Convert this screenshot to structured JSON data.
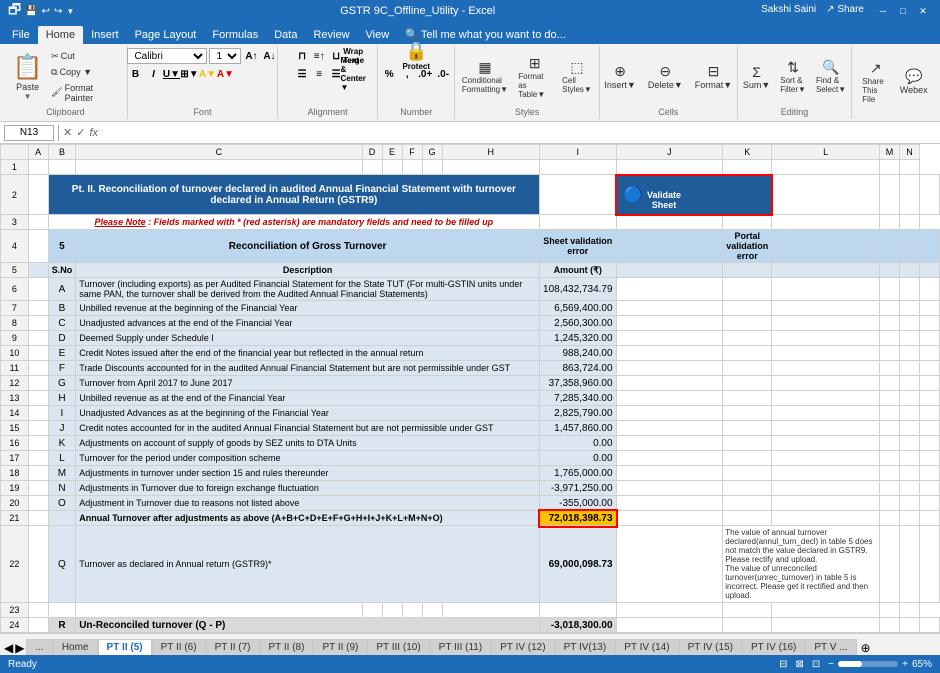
{
  "titleBar": {
    "title": "GSTR 9C_Offline_Utility - Excel",
    "minimize": "─",
    "maximize": "□",
    "close": "✕"
  },
  "tabs": [
    "File",
    "Home",
    "Insert",
    "Page Layout",
    "Formulas",
    "Data",
    "Review",
    "View",
    "Tell me what you want to do..."
  ],
  "activeTab": "Home",
  "ribbon": {
    "groups": [
      {
        "label": "Clipboard",
        "name": "clipboard"
      },
      {
        "label": "Font",
        "name": "font"
      },
      {
        "label": "Alignment",
        "name": "alignment"
      },
      {
        "label": "Number",
        "name": "number"
      },
      {
        "label": "Styles",
        "name": "styles"
      },
      {
        "label": "Cells",
        "name": "cells"
      },
      {
        "label": "Editing",
        "name": "editing"
      }
    ],
    "fontName": "Calibri",
    "fontSize": "11",
    "userInfo": "Sakshi Saini"
  },
  "formulaBar": {
    "nameBox": "N13",
    "formula": ""
  },
  "sheet": {
    "validateBtn": "Validate\nSheet",
    "heading": "Pt. II. Reconciliation of turnover declared in audited Annual Financial Statement with turnover declared in Annual Return (GSTR9)",
    "note": "Please Note : Fields marked with  * (red asterisk) are mandatory fields and need to be filled up",
    "sectionTitle": "Reconciliation of Gross Turnover",
    "colHeaders": [
      "A",
      "B",
      "C",
      "D",
      "E",
      "F",
      "G",
      "H",
      "I",
      "J",
      "K",
      "L",
      "M",
      "N"
    ],
    "rows": [
      {
        "row": "1",
        "cells": {}
      },
      {
        "row": "2",
        "cells": {
          "b": "Pt. II. Reconciliation of turnover declared in audited Annual Financial Statement with turnover declared in Annual Return (GSTR9)"
        }
      },
      {
        "row": "3",
        "cells": {
          "b": "Please Note : Fields marked with * (red asterisk) are mandatory fields and need to be filled up"
        }
      },
      {
        "row": "4",
        "cells": {
          "b": "5",
          "c": "Reconciliation of Gross Turnover",
          "h": "Sheet validation error",
          "j": "Portal validation error"
        }
      },
      {
        "row": "5",
        "cells": {
          "b": "S.No",
          "c": "Description",
          "h": "Amount (₹)"
        }
      },
      {
        "row": "6",
        "cells": {
          "b": "A",
          "c": "Turnover (including exports) as per Audited Financial Statement for the State TUT (For multi-GSTIN units under same PAN, the turnover shall be derived from the Audited Annual Financial Statements)",
          "h": "108,432,734.79"
        }
      },
      {
        "row": "7",
        "cells": {
          "b": "B",
          "c": "Unbilled revenue at the beginning of the Financial Year",
          "h": "6,569,400.00"
        }
      },
      {
        "row": "8",
        "cells": {
          "b": "C",
          "c": "Unadjusted advances at the end of the Financial Year",
          "h": "2,560,300.00"
        }
      },
      {
        "row": "9",
        "cells": {
          "b": "D",
          "c": "Deemed Supply under Schedule I",
          "h": "1,245,320.00"
        }
      },
      {
        "row": "10",
        "cells": {
          "b": "E",
          "c": "Credit Notes issued after the end of the financial year but reflected in the annual return",
          "h": "988,240.00"
        }
      },
      {
        "row": "11",
        "cells": {
          "b": "F",
          "c": "Trade Discounts accounted for in the audited Annual Financial Statement but are not permissible under GST",
          "h": "863,724.00"
        }
      },
      {
        "row": "12",
        "cells": {
          "b": "G",
          "c": "Turnover from April 2017 to June 2017",
          "h": "37,358,960.00"
        }
      },
      {
        "row": "13",
        "cells": {
          "b": "H",
          "c": "Unbilled revenue as at the end of the Financial Year",
          "h": "7,285,340.00"
        }
      },
      {
        "row": "14",
        "cells": {
          "b": "I",
          "c": "Unadjusted Advances as at the beginning of the Financial Year",
          "h": "2,825,790.00"
        }
      },
      {
        "row": "15",
        "cells": {
          "b": "J",
          "c": "Credit notes accounted for in the audited Annual Financial Statement but are not permissible under GST",
          "h": "1,457,860.00"
        }
      },
      {
        "row": "16",
        "cells": {
          "b": "K",
          "c": "Adjustments on account of supply of goods by SEZ units to DTA Units",
          "h": "0.00"
        }
      },
      {
        "row": "17",
        "cells": {
          "b": "L",
          "c": "Turnover for the period under composition scheme",
          "h": "0.00"
        }
      },
      {
        "row": "18",
        "cells": {
          "b": "M",
          "c": "Adjustments in turnover under section 15 and rules thereunder",
          "h": "1,765,000.00"
        }
      },
      {
        "row": "19",
        "cells": {
          "b": "N",
          "c": "Adjustments in Turnover due to foreign exchange fluctuation",
          "h": "-3,971,250.00"
        }
      },
      {
        "row": "20",
        "cells": {
          "b": "O",
          "c": "Adjustment in Turnover due to reasons not listed above",
          "h": "-355,000.00"
        }
      },
      {
        "row": "21",
        "cells": {
          "b": "",
          "c": "Annual Turnover after adjustments as above (A+B+C+D+E+F+G+H+I+J+K+L+M+N+O)",
          "h": "72,018,398.73"
        }
      },
      {
        "row": "22",
        "cells": {
          "b": "Q",
          "c": "Turnover as declared in Annual return (GSTR9)*",
          "h": "69,000,098.73",
          "j_error": "The value of annual turnover declared(annul_turn_decl) in table 5 does not match the value declared in GSTR9. Please rectify and upload.\nThe value of unreconciled turnover(unrec_turnover) in table 5 is incorrect. Please get it rectified and then upload."
        }
      },
      {
        "row": "23",
        "cells": {}
      },
      {
        "row": "24",
        "cells": {
          "b": "R",
          "c": "Un-Reconciled turnover  (Q - P)",
          "h": "-3,018,300.00"
        }
      }
    ]
  },
  "sheetTabs": [
    "...",
    "Home",
    "PT II (5)",
    "PT II (6)",
    "PT II (7)",
    "PT II (8)",
    "PT II (9)",
    "PT III (10)",
    "PT III (11)",
    "PT IV (12)",
    "PT IV(13)",
    "PT IV (14)",
    "PT IV (15)",
    "PT IV (16)",
    "PT V ..."
  ],
  "activeSheetTab": "PT II (5)",
  "statusBar": {
    "ready": "Ready",
    "zoom": "65%"
  }
}
